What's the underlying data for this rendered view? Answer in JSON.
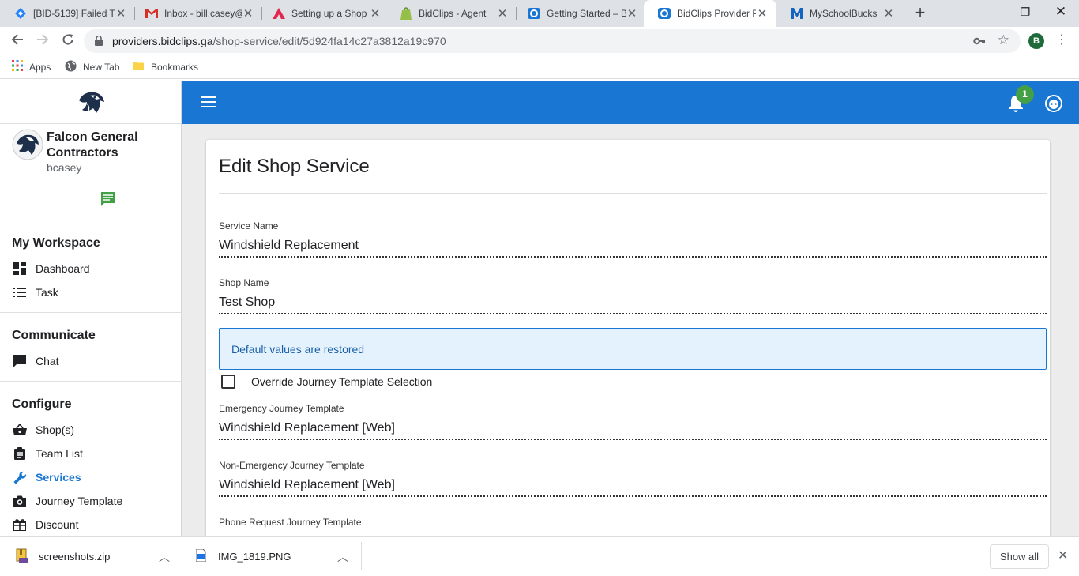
{
  "browser": {
    "tabs": [
      {
        "title": "[BID-5139] Failed T",
        "icon": "jira-icon"
      },
      {
        "title": "Inbox - bill.casey@",
        "icon": "gmail-icon"
      },
      {
        "title": "Setting up a Shop",
        "icon": "atlassian-icon"
      },
      {
        "title": "BidClips - Agent",
        "icon": "shopify-icon"
      },
      {
        "title": "Getting Started – B",
        "icon": "bidclips-icon"
      },
      {
        "title": "BidClips Provider P",
        "icon": "bidclips-icon"
      },
      {
        "title": "MySchoolBucks",
        "icon": "myschoolbucks-icon"
      }
    ],
    "address": {
      "host": "providers.bidclips.ga",
      "path": "/shop-service/edit/5d924fa14c27a3812a19c970"
    },
    "profile_initial": "B",
    "bookmarks": {
      "apps": "Apps",
      "new_tab": "New Tab",
      "bookmarks": "Bookmarks"
    }
  },
  "sidebar": {
    "org_name": "Falcon General Contractors",
    "username": "bcasey",
    "sections": {
      "workspace": {
        "title": "My Workspace",
        "items": [
          "Dashboard",
          "Task"
        ]
      },
      "communicate": {
        "title": "Communicate",
        "items": [
          "Chat"
        ]
      },
      "configure": {
        "title": "Configure",
        "items": [
          "Shop(s)",
          "Team List",
          "Services",
          "Journey Template",
          "Discount"
        ]
      }
    }
  },
  "header": {
    "notification_count": "1",
    "accent": "#1976d2",
    "badge_color": "#43a047"
  },
  "form": {
    "title": "Edit Shop Service",
    "service_name": {
      "label": "Service Name",
      "value": "Windshield Replacement"
    },
    "shop_name": {
      "label": "Shop Name",
      "value": "Test Shop"
    },
    "alert": "Default values are restored",
    "override": {
      "label": "Override Journey Template Selection",
      "checked": false
    },
    "emergency": {
      "label": "Emergency Journey Template",
      "value": "Windshield Replacement [Web]"
    },
    "non_emergency": {
      "label": "Non-Emergency Journey Template",
      "value": "Windshield Replacement [Web]"
    },
    "phone": {
      "label": "Phone Request Journey Template"
    }
  },
  "downloads": {
    "items": [
      {
        "name": "screenshots.zip"
      },
      {
        "name": "IMG_1819.PNG"
      }
    ],
    "show_all": "Show all"
  }
}
